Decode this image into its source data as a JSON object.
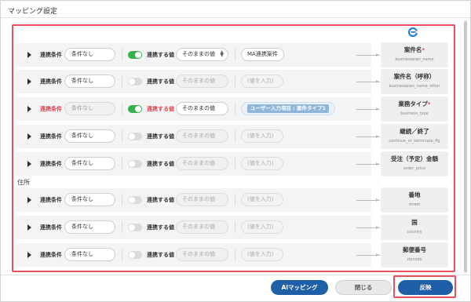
{
  "dialog": {
    "title": "マッピング設定"
  },
  "section": {
    "address_label": "住所"
  },
  "labels": {
    "condition": "連携条件",
    "value": "連携する値"
  },
  "colors": {
    "accent": "#1f5fa8",
    "toggle_on": "#35b34a",
    "required": "#e0434f",
    "highlight": "#e8505b"
  },
  "rows": [
    {
      "condition": "条件なし",
      "toggle": "on",
      "value_mode": "そのままの値",
      "value_mode_dropdown": true,
      "value": "MA連携案件",
      "value_type": "text",
      "target_name": "案件名",
      "required": "*",
      "target_key": "businessplan_name",
      "red": false
    },
    {
      "condition": "条件なし",
      "toggle": "off",
      "value_mode": "そのままの値",
      "value_mode_dropdown": false,
      "value": "(値を入力)",
      "value_type": "placeholder",
      "target_name": "案件名（呼称）",
      "required": "",
      "target_key": "businessplan_name_other",
      "red": false
    },
    {
      "condition": "条件なし",
      "toggle": "on",
      "value_mode": "そのままの値",
      "value_mode_dropdown": false,
      "value": "ユーザー入力項目 : 案件タイプ1",
      "value_type": "chip",
      "target_name": "業務タイプ",
      "required": "*",
      "target_key": "business_type",
      "red": true
    },
    {
      "condition": "条件なし",
      "toggle": "off",
      "value_mode": "そのままの値",
      "value_mode_dropdown": false,
      "value": "(値を入力)",
      "value_type": "placeholder",
      "target_name": "継続／終了",
      "required": "",
      "target_key": "continue_or_terminate_flg",
      "red": false
    },
    {
      "condition": "条件なし",
      "toggle": "off",
      "value_mode": "そのままの値",
      "value_mode_dropdown": false,
      "value": "(値を入力)",
      "value_type": "placeholder",
      "target_name": "受注（予定）金額",
      "required": "",
      "target_key": "order_price",
      "red": false
    },
    {
      "condition": "条件なし",
      "toggle": "off",
      "value_mode": "そのままの値",
      "value_mode_dropdown": false,
      "value": "(値を入力)",
      "value_type": "placeholder",
      "target_name": "番地",
      "required": "",
      "target_key": "street",
      "red": false
    },
    {
      "condition": "条件なし",
      "toggle": "off",
      "value_mode": "そのままの値",
      "value_mode_dropdown": false,
      "value": "(値を入力)",
      "value_type": "placeholder",
      "target_name": "国",
      "required": "",
      "target_key": "country",
      "red": false
    },
    {
      "condition": "条件なし",
      "toggle": "off",
      "value_mode": "そのままの値",
      "value_mode_dropdown": false,
      "value": "(値を入力)",
      "value_type": "placeholder",
      "target_name": "郵便番号",
      "required": "",
      "target_key": "zipcode",
      "red": false
    }
  ],
  "footer": {
    "ai_button": "AIマッピング",
    "close_button": "閉じる",
    "apply_button": "反映"
  }
}
